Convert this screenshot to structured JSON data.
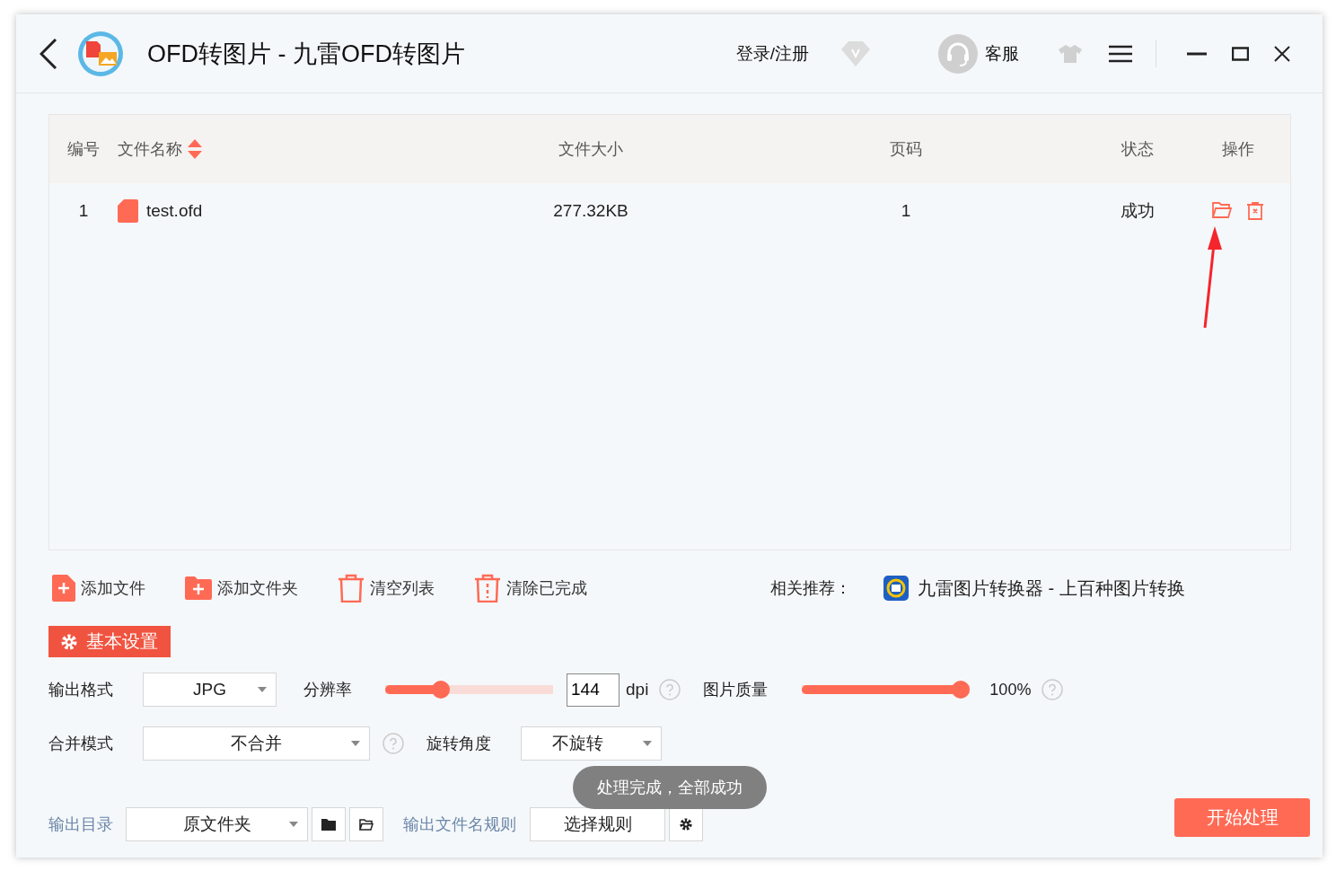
{
  "window": {
    "title": "OFD转图片 - 九雷OFD转图片"
  },
  "header": {
    "login": "登录/注册",
    "support": "客服"
  },
  "table": {
    "columns": [
      {
        "label": "编号",
        "sortable": false
      },
      {
        "label": "文件名称",
        "sortable": true
      },
      {
        "label": "文件大小",
        "sortable": false
      },
      {
        "label": "页码",
        "sortable": false
      },
      {
        "label": "状态",
        "sortable": false
      },
      {
        "label": "操作",
        "sortable": false
      }
    ],
    "rows": [
      {
        "index": "1",
        "name": "test.ofd",
        "size": "277.32KB",
        "pages": "1",
        "status": "成功"
      }
    ]
  },
  "toolbar": {
    "actions": [
      {
        "label": "添加文件",
        "kind": "file"
      },
      {
        "label": "添加文件夹",
        "kind": "folder"
      },
      {
        "label": "清空列表",
        "kind": "trash"
      },
      {
        "label": "清除已完成",
        "kind": "trash-dots"
      }
    ],
    "recommend_label": "相关推荐：",
    "recommend_app": "九雷图片转换器 - 上百种图片转换"
  },
  "settings_tab": {
    "label": "基本设置",
    "selected": true
  },
  "settings": {
    "output_format": {
      "label": "输出格式",
      "value": "JPG"
    },
    "resolution": {
      "label": "分辨率",
      "level": 0.31,
      "value": "144",
      "unit": "dpi"
    },
    "quality": {
      "label": "图片质量",
      "level": 1,
      "reading": "100%"
    },
    "merge": {
      "label": "合并模式",
      "value": "不合并"
    },
    "rotate": {
      "label": "旋转角度",
      "value": "不旋转"
    },
    "output_dir": {
      "label": "输出目录",
      "value": "原文件夹"
    },
    "filename_rule": {
      "label": "输出文件名规则",
      "value": "选择规则"
    }
  },
  "toast": "处理完成，全部成功",
  "start_button": "开始处理"
}
